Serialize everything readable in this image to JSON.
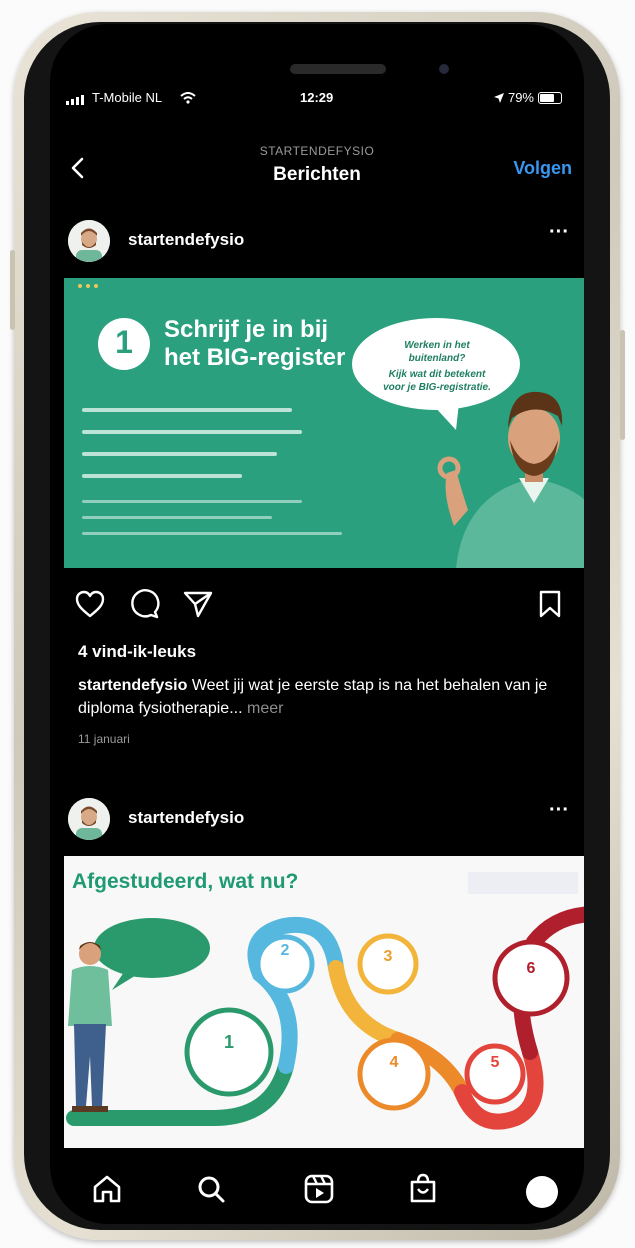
{
  "status_bar": {
    "carrier": "T-Mobile NL",
    "time": "12:29",
    "battery": "79%",
    "battery_level": 0.79
  },
  "nav": {
    "subtitle": "STARTENDEFYSIO",
    "title": "Berichten",
    "follow_label": "Volgen"
  },
  "posts": [
    {
      "username": "startendefysio",
      "slide": {
        "number": "1",
        "title_line1": "Schrijf je in bij",
        "title_line2": "het BIG-register",
        "bubble_line1": "Werken in het",
        "bubble_line2": "buitenland?",
        "bubble_line3": "Kijk wat dit betekent",
        "bubble_line4": "voor je BIG-registratie."
      },
      "likes": "4 vind-ik-leuks",
      "caption_text": "Weet jij wat je eerste stap is na het behalen van je diploma fysiotherapie...",
      "caption_more": "meer",
      "date": "11 januari"
    },
    {
      "username": "startendefysio",
      "slide": {
        "title": "Afgestudeerd, wat nu?",
        "steps": [
          "1",
          "2",
          "3",
          "4",
          "5",
          "6"
        ]
      }
    }
  ],
  "icons": [
    "back-icon",
    "more-icon",
    "heart-icon",
    "comment-icon",
    "share-icon",
    "bookmark-icon",
    "home-icon",
    "search-icon",
    "reels-icon",
    "shop-icon",
    "profile-icon"
  ],
  "colors": {
    "follow": "#3897f0",
    "slide_green": "#2aa07e",
    "slide_title_green": "#1f9a73"
  }
}
